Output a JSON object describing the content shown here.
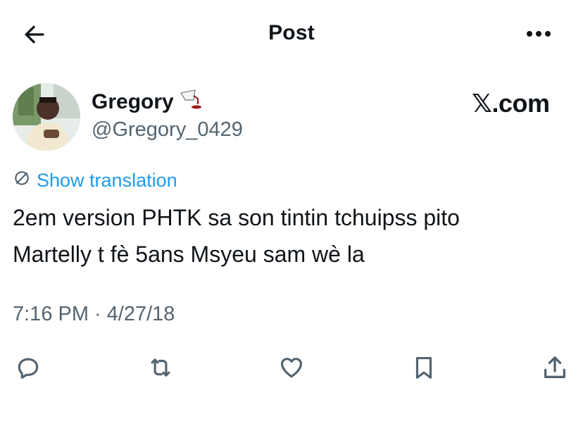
{
  "header": {
    "title": "Post",
    "back_icon": "arrow-left-icon",
    "more_icon": "more-horizontal-icon"
  },
  "author": {
    "display_name": "Gregory",
    "handle": "@Gregory_0429",
    "name_emoji": "pouring-glass-emoji",
    "avatar": "profile-photo"
  },
  "brand": {
    "label": "𝕏.com"
  },
  "translation": {
    "label": "Show translation",
    "icon": "globe-icon"
  },
  "post": {
    "text_line1": "2em version PHTK sa son tintin tchuipss pito",
    "text_line2": "Martelly t fè 5ans Msyeu sam wè la"
  },
  "meta": {
    "time": "7:16 PM",
    "separator": "·",
    "date": "4/27/18"
  },
  "actions": [
    {
      "name": "reply",
      "icon": "reply-icon"
    },
    {
      "name": "repost",
      "icon": "repost-icon"
    },
    {
      "name": "like",
      "icon": "heart-icon"
    },
    {
      "name": "bookmark",
      "icon": "bookmark-icon"
    },
    {
      "name": "share",
      "icon": "share-icon"
    }
  ],
  "colors": {
    "text": "#0f1419",
    "secondary": "#536471",
    "link": "#1d9bf0",
    "background": "#ffffff"
  }
}
